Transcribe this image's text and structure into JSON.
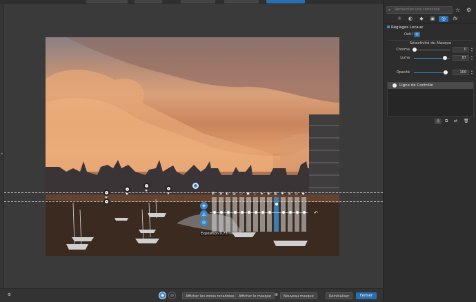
{
  "panel": {
    "search_placeholder": "Rechercher une correction",
    "icons": [
      "star-icon",
      "gear-icon"
    ],
    "tabs": [
      {
        "name": "tab-light",
        "glyph": "☼"
      },
      {
        "name": "tab-color",
        "glyph": "◐"
      },
      {
        "name": "tab-detail",
        "glyph": "◆"
      },
      {
        "name": "tab-geometry",
        "glyph": "▣"
      },
      {
        "name": "tab-local",
        "glyph": "◎",
        "active": true
      },
      {
        "name": "tab-effects",
        "glyph": "fx"
      }
    ],
    "section_title": "Réglages Locaux",
    "tool_label": "Outil",
    "subhead": "Sélectivité du Masque",
    "sliders": [
      {
        "label": "Chroma",
        "value": "0",
        "fraction": 0.0
      },
      {
        "label": "Luma",
        "value": "87",
        "fraction": 0.87
      },
      {
        "label": "Opacité",
        "value": "100",
        "fraction": 1.0
      }
    ],
    "mask_item": "Ligne de Contrôle"
  },
  "bottom": {
    "show_zones": "Afficher les zones recadrées",
    "show_mask": "Afficher le masque",
    "new_mask": "Nouveau masque",
    "reset": "Réinitialiser",
    "close": "Fermer"
  },
  "overlay": {
    "exposure_label": "Exposition 0.73"
  },
  "colors": {
    "accent": "#2a6fb0",
    "panel_bg": "#2d2d2d",
    "canvas_bg": "#3a3a3a"
  }
}
